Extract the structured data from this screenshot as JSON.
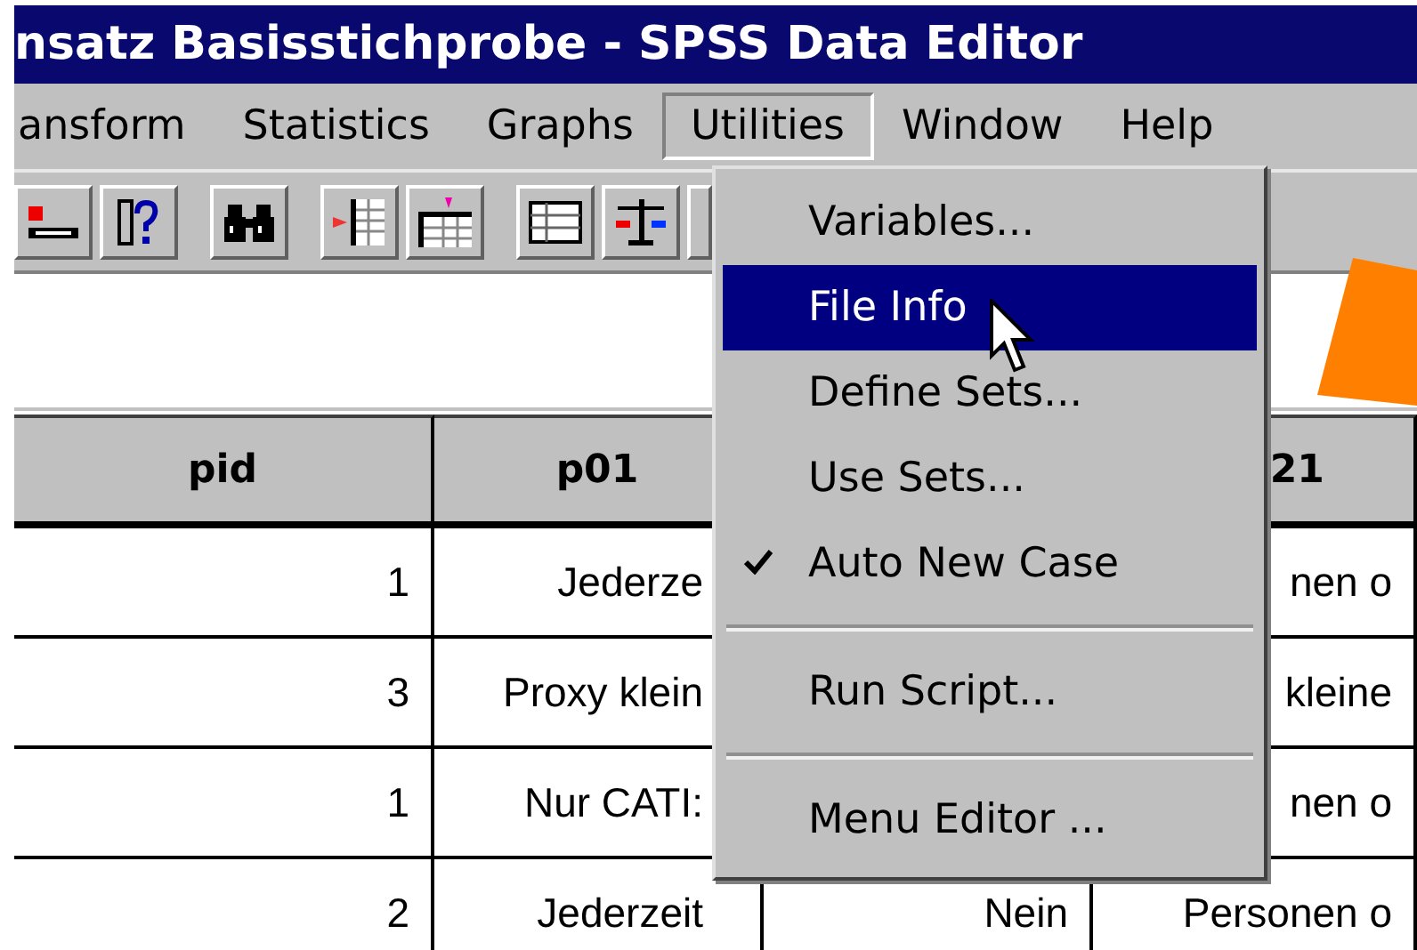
{
  "window": {
    "title": "nsatz Basisstichprobe - SPSS Data Editor"
  },
  "menu_bar": [
    {
      "label": "ansform",
      "selected": false
    },
    {
      "label": "Statistics",
      "selected": false
    },
    {
      "label": "Graphs",
      "selected": false
    },
    {
      "label": "Utilities",
      "selected": true
    },
    {
      "label": "Window",
      "selected": false
    },
    {
      "label": "Help",
      "selected": false
    }
  ],
  "open_menu": {
    "items": [
      {
        "kind": "item",
        "label": "Variables...",
        "selected": false,
        "checked": false
      },
      {
        "kind": "item",
        "label": "File Info",
        "selected": true,
        "checked": false
      },
      {
        "kind": "item",
        "label": "Define Sets...",
        "selected": false,
        "checked": false
      },
      {
        "kind": "item",
        "label": "Use Sets...",
        "selected": false,
        "checked": false
      },
      {
        "kind": "item",
        "label": "Auto New Case",
        "selected": false,
        "checked": true
      },
      {
        "kind": "separator"
      },
      {
        "kind": "item",
        "label": "Run Script...",
        "selected": false,
        "checked": false
      },
      {
        "kind": "separator"
      },
      {
        "kind": "item",
        "label": "Menu Editor ...",
        "selected": false,
        "checked": false
      }
    ]
  },
  "table": {
    "columns": [
      {
        "label": "pid"
      },
      {
        "label": "p01"
      },
      {},
      {
        "label": "21"
      }
    ],
    "rows": [
      {
        "cells": [
          "1",
          "Jederze",
          null,
          "nen o"
        ]
      },
      {
        "cells": [
          "3",
          "Proxy klein",
          null,
          "kleine"
        ]
      },
      {
        "cells": [
          "1",
          "Nur CATI:",
          null,
          "nen o"
        ]
      },
      {
        "cells": [
          "2",
          "Jederzeit",
          "Nein",
          "Personen o"
        ]
      }
    ]
  }
}
